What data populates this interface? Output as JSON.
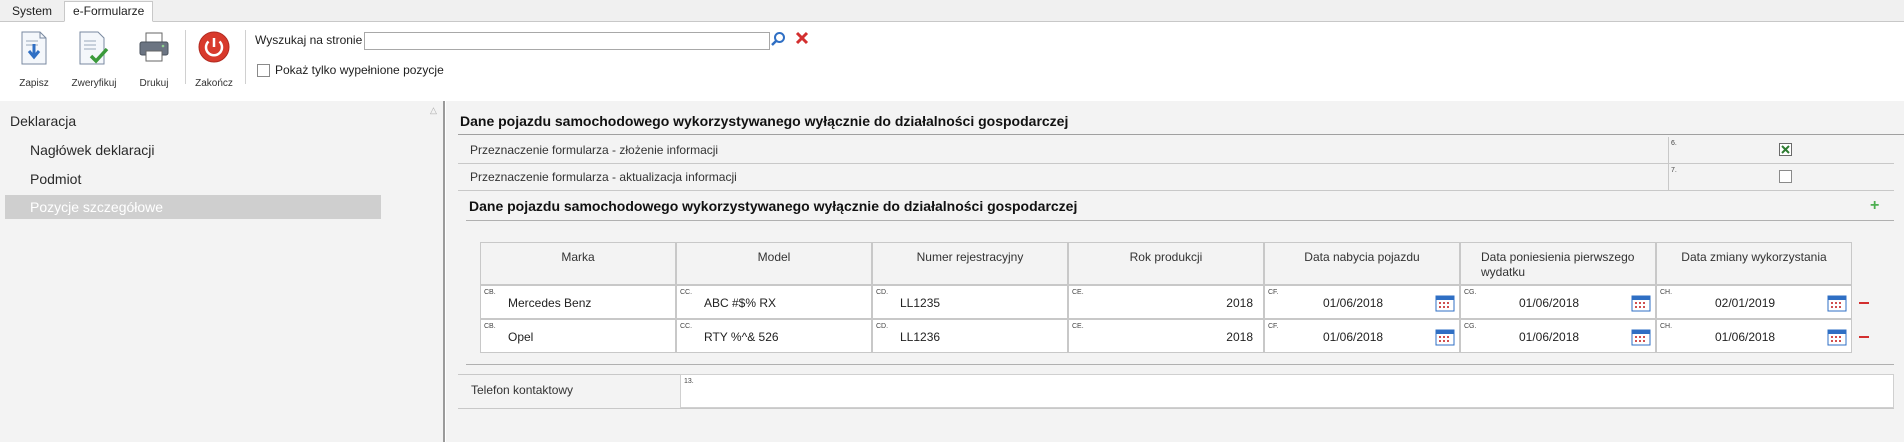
{
  "tabs": [
    "System",
    "e-Formularze"
  ],
  "toolbar": {
    "save_label": "Zapisz",
    "verify_label": "Zweryfikuj",
    "print_label": "Drukuj",
    "close_label": "Zakończ",
    "search_label": "Wyszukaj na stronie",
    "search_value": "",
    "show_filled_label": "Pokaż tylko wypełnione pozycje"
  },
  "nav": {
    "root": "Deklaracja",
    "items": [
      "Nagłówek deklaracji",
      "Podmiot",
      "Pozycje szczegółowe"
    ],
    "selected": "Pozycje szczegółowe"
  },
  "main": {
    "section_title": "Dane pojazdu samochodowego wykorzystywanego wyłącznie do działalności gospodarczej",
    "purpose_rows": [
      {
        "label": "Przeznaczenie formularza - złożenie informacji",
        "field_no": "6.",
        "checked": true
      },
      {
        "label": "Przeznaczenie formularza - aktualizacja informacji",
        "field_no": "7.",
        "checked": false
      }
    ],
    "subsection_title": "Dane pojazdu samochodowego wykorzystywanego wyłącznie do działalności gospodarczej",
    "table": {
      "headers": [
        "Marka",
        "Model",
        "Numer rejestracyjny",
        "Rok produkcji",
        "Data nabycia pojazdu",
        "Data poniesienia pierwszego wydatku",
        "Data zmiany wykorzystania"
      ],
      "rows": [
        {
          "marka_no": "CB.",
          "marka": "Mercedes Benz",
          "model_no": "CC.",
          "model": "ABC #$% RX",
          "nr_no": "CD.",
          "nr": "LL1235",
          "rok_no": "CE.",
          "rok": "2018",
          "nabycie_no": "CF.",
          "nabycie": "01/06/2018",
          "wydatek_no": "CG.",
          "wydatek": "01/06/2018",
          "zmiana_no": "CH.",
          "zmiana": "02/01/2019"
        },
        {
          "marka_no": "CB.",
          "marka": "Opel",
          "model_no": "CC.",
          "model": "RTY %^& 526",
          "nr_no": "CD.",
          "nr": "LL1236",
          "rok_no": "CE.",
          "rok": "2018",
          "nabycie_no": "CF.",
          "nabycie": "01/06/2018",
          "wydatek_no": "CG.",
          "wydatek": "01/06/2018",
          "zmiana_no": "CH.",
          "zmiana": "01/06/2018"
        }
      ]
    },
    "phone_label": "Telefon kontaktowy",
    "phone_field_no": "13.",
    "phone_value": ""
  },
  "colors": {
    "accent_plus": "#4caf50",
    "remove_red": "#d32f2f",
    "close_red": "#d32f2f",
    "selected_nav": "#cfcfcf"
  },
  "icons": [
    "save-icon",
    "verify-icon",
    "print-icon",
    "power-icon",
    "search-icon",
    "clear-icon",
    "calendar-icon",
    "plus-icon",
    "minus-icon"
  ]
}
